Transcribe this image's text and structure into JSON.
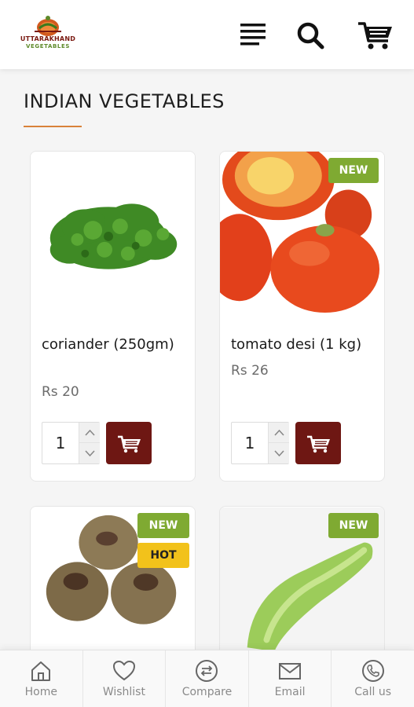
{
  "header": {
    "logo_line1": "UTTARAKHAND",
    "logo_line2": "VEGETABLES"
  },
  "section_title": "INDIAN VEGETABLES",
  "products": [
    {
      "name": "coriander (250gm)",
      "price": "Rs 20",
      "quantity": "1",
      "badges": []
    },
    {
      "name": "tomato desi (1 kg)",
      "price": "Rs 26",
      "quantity": "1",
      "badges": [
        "NEW"
      ]
    },
    {
      "name": "",
      "price": "",
      "quantity": "",
      "badges": [
        "NEW",
        "HOT"
      ]
    },
    {
      "name": "",
      "price": "",
      "quantity": "",
      "badges": [
        "NEW"
      ]
    }
  ],
  "bottom_nav": [
    {
      "label": "Home",
      "icon": "home-icon"
    },
    {
      "label": "Wishlist",
      "icon": "heart-icon"
    },
    {
      "label": "Compare",
      "icon": "compare-icon"
    },
    {
      "label": "Email",
      "icon": "email-icon"
    },
    {
      "label": "Call us",
      "icon": "phone-icon"
    }
  ],
  "colors": {
    "accent": "#d9823a",
    "cart_button": "#6e1713",
    "badge_new": "#7faa32",
    "badge_hot": "#f2c21b"
  }
}
